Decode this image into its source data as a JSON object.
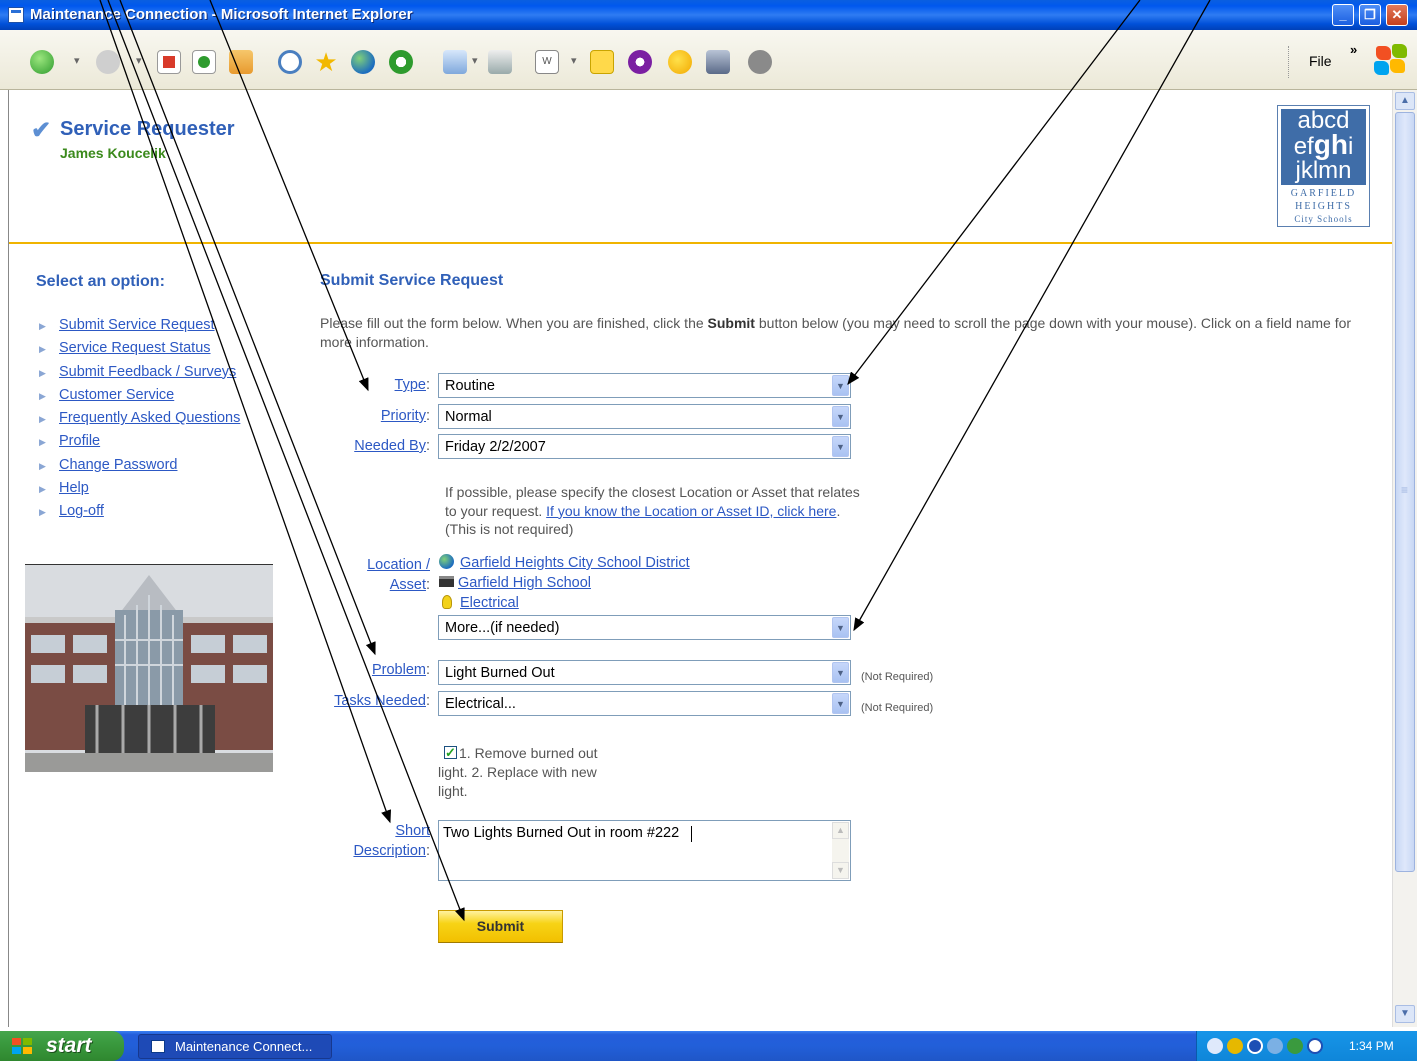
{
  "window": {
    "title": "Maintenance Connection - Microsoft Internet Explorer"
  },
  "toolbar": {
    "file_label": "File",
    "overflow_label": "»"
  },
  "header": {
    "app_name": "Service Requester",
    "user_name": "James Koucelik",
    "logo": {
      "letters": "abcdefghijklmn",
      "line1": "GARFIELD",
      "line2": "HEIGHTS",
      "line3": "City Schools"
    }
  },
  "sidebar": {
    "title": "Select an option:",
    "items": [
      {
        "label": "Submit Service Request"
      },
      {
        "label": "Service Request Status"
      },
      {
        "label": "Submit Feedback / Surveys"
      },
      {
        "label": "Customer Service"
      },
      {
        "label": "Frequently Asked Questions"
      },
      {
        "label": "Profile"
      },
      {
        "label": "Change Password"
      },
      {
        "label": "Help"
      },
      {
        "label": "Log-off"
      }
    ]
  },
  "form": {
    "title": "Submit Service Request",
    "intro_before": "Please fill out the form below. When you are finished, click the ",
    "intro_bold": "Submit",
    "intro_after": " button below (you may need to scroll the page down with your mouse). Click on a field name for more information.",
    "type": {
      "label": "Type",
      "value": "Routine"
    },
    "priority": {
      "label": "Priority",
      "value": "Normal"
    },
    "needed_by": {
      "label": "Needed By",
      "value": "Friday 2/2/2007"
    },
    "location_note_before": "If possible, please specify the closest Location or Asset that relates to your request. ",
    "location_note_link": "If you know the Location or Asset ID, click here",
    "location_note_after": ". (This is not required)",
    "location": {
      "label_line1": "Location /",
      "label_line2": "Asset",
      "items": [
        "Garfield Heights City School District",
        "Garfield High School",
        "Electrical"
      ],
      "more_value": "More...(if needed)"
    },
    "problem": {
      "label": "Problem",
      "value": "Light Burned Out",
      "note": "(Not Required)"
    },
    "tasks": {
      "label": "Tasks Needed",
      "value": "Electrical...",
      "note": "(Not Required)"
    },
    "task_item": "1. Remove burned out light. 2. Replace with new light.",
    "short_desc": {
      "label_line1": "Short",
      "label_line2": "Description",
      "value": "Two Lights Burned Out in room #222"
    },
    "submit_label": "Submit"
  },
  "taskbar": {
    "start_label": "start",
    "task_label": "Maintenance Connect...",
    "clock": "1:34 PM"
  },
  "colors": {
    "accent_blue": "#3060b8",
    "user_green": "#3b8a1c",
    "divider_gold": "#f0b400",
    "submit_yellow": "#f7d316"
  }
}
